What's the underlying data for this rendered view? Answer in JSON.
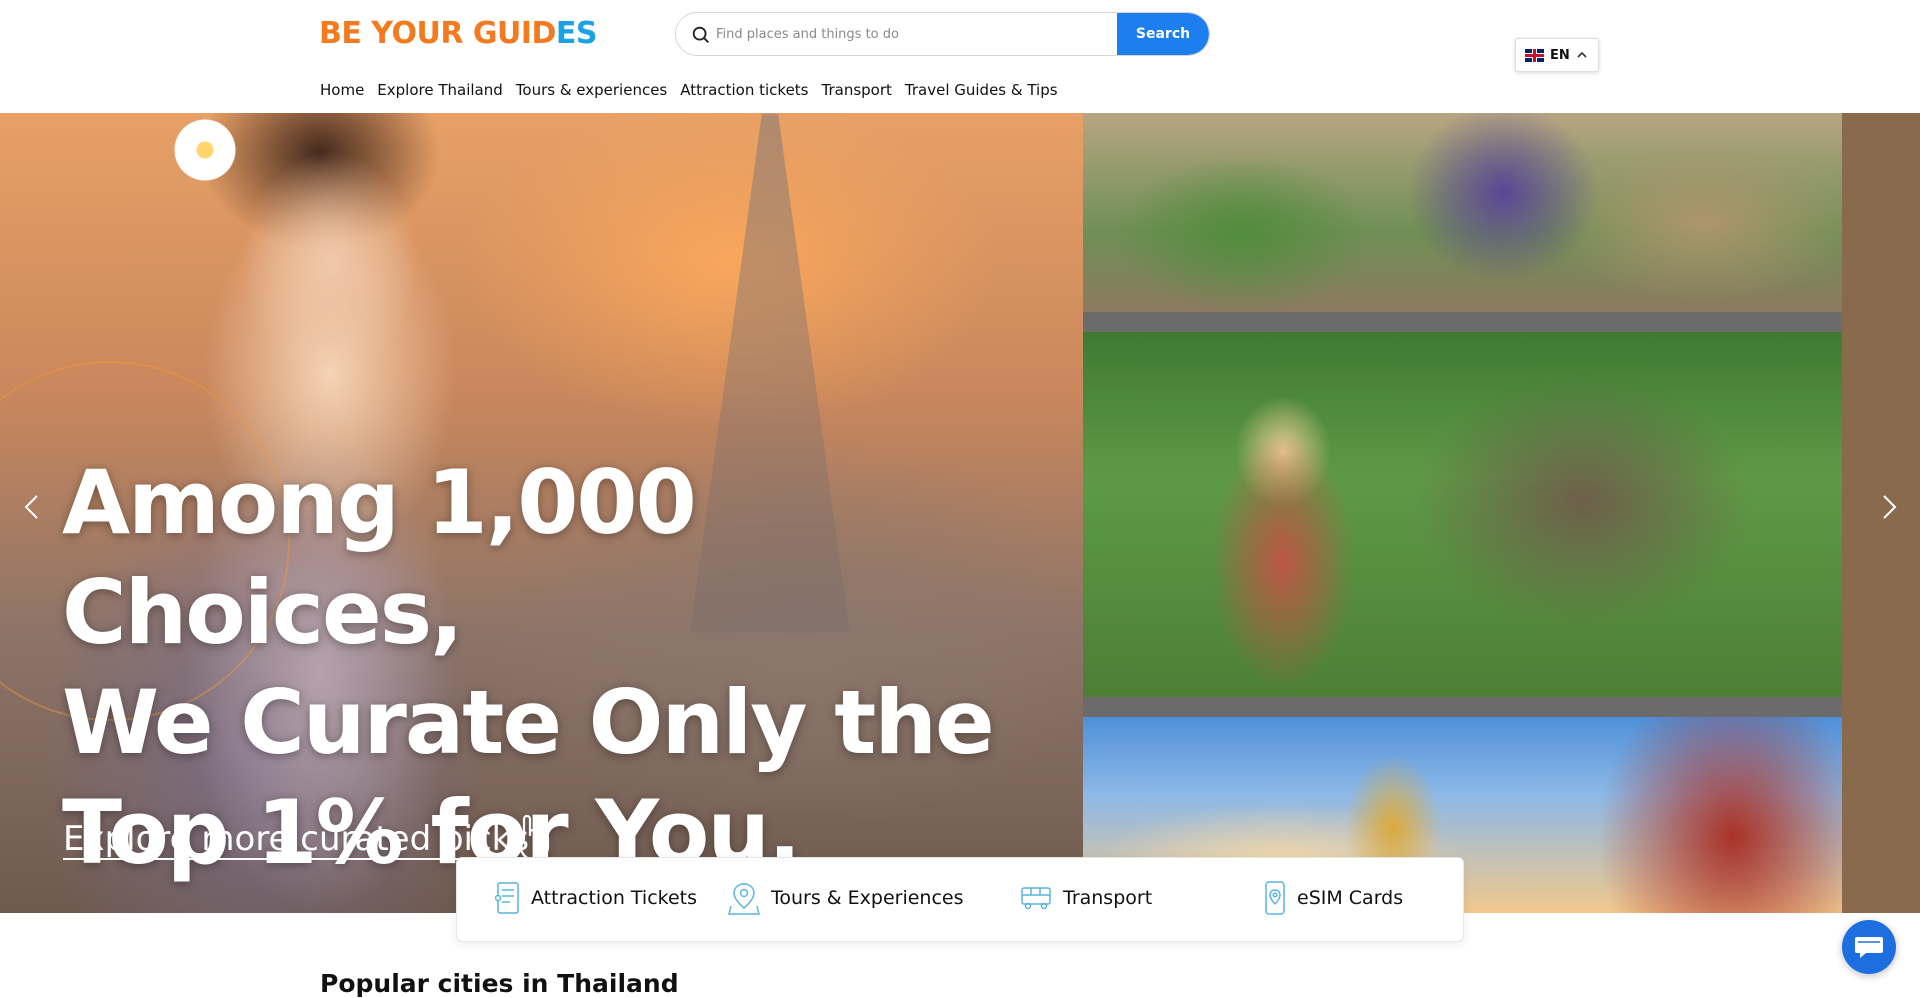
{
  "header": {
    "logo_text_a": "BE YOUR GUID",
    "logo_text_b": "ES",
    "search": {
      "placeholder": "Find places and things to do",
      "button_label": "Search"
    },
    "language": {
      "label": "EN",
      "icon": "uk-flag-icon"
    }
  },
  "nav": {
    "items": [
      {
        "label": "Home"
      },
      {
        "label": "Explore Thailand"
      },
      {
        "label": "Tours & experiences"
      },
      {
        "label": "Attraction tickets"
      },
      {
        "label": "Transport"
      },
      {
        "label": "Travel Guides & Tips"
      }
    ]
  },
  "hero": {
    "title_line_1": "Among 1,000 Choices,",
    "title_line_2": "We Curate Only the",
    "title_line_3": "Top 1% for You.",
    "link_label": "Explore more curated picks",
    "prev_icon": "chevron-left-icon",
    "next_icon": "chevron-right-icon"
  },
  "categories": [
    {
      "label": "Attraction Tickets",
      "icon": "ticket-icon"
    },
    {
      "label": "Tours & Experiences",
      "icon": "map-pin-icon"
    },
    {
      "label": "Transport",
      "icon": "bus-icon"
    },
    {
      "label": "eSIM Cards",
      "icon": "sim-card-icon"
    }
  ],
  "sections": {
    "popular_cities_title": "Popular cities in Thailand"
  },
  "colors": {
    "brand_orange": "#f47a1f",
    "brand_blue": "#1aa1e6",
    "search_button": "#1d7ef0",
    "chat_button": "#1d6fe0"
  }
}
